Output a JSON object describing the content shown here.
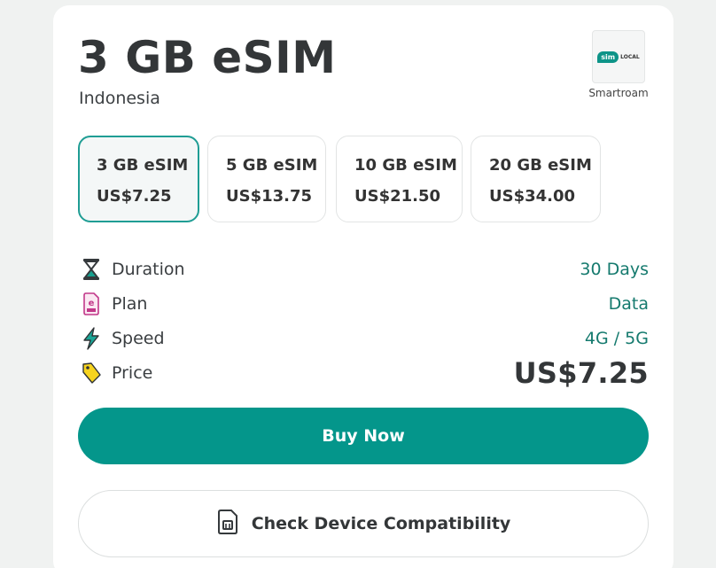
{
  "header": {
    "title": "3 GB eSIM",
    "country": "Indonesia"
  },
  "provider": {
    "logo_mark": "sim",
    "logo_word": "LOCAL",
    "name": "Smartroam"
  },
  "plans": [
    {
      "name": "3 GB eSIM",
      "price": "US$7.25",
      "selected": true
    },
    {
      "name": "5 GB eSIM",
      "price": "US$13.75",
      "selected": false
    },
    {
      "name": "10 GB eSIM",
      "price": "US$21.50",
      "selected": false
    },
    {
      "name": "20 GB eSIM",
      "price": "US$34.00",
      "selected": false
    }
  ],
  "details": {
    "duration": {
      "icon": "hourglass-icon",
      "label": "Duration",
      "value": "30 Days"
    },
    "plan": {
      "icon": "esim-card-icon",
      "label": "Plan",
      "value": "Data"
    },
    "speed": {
      "icon": "lightning-icon",
      "label": "Speed",
      "value": "4G / 5G"
    },
    "price": {
      "icon": "price-tag-icon",
      "label": "Price",
      "value": "US$7.25"
    }
  },
  "actions": {
    "buy_label": "Buy Now",
    "check_label": "Check Device Compatibility",
    "check_icon": "sim-card-icon"
  },
  "colors": {
    "accent": "#04968b",
    "value_text": "#157a6e",
    "selected_border": "#1f9d94"
  }
}
